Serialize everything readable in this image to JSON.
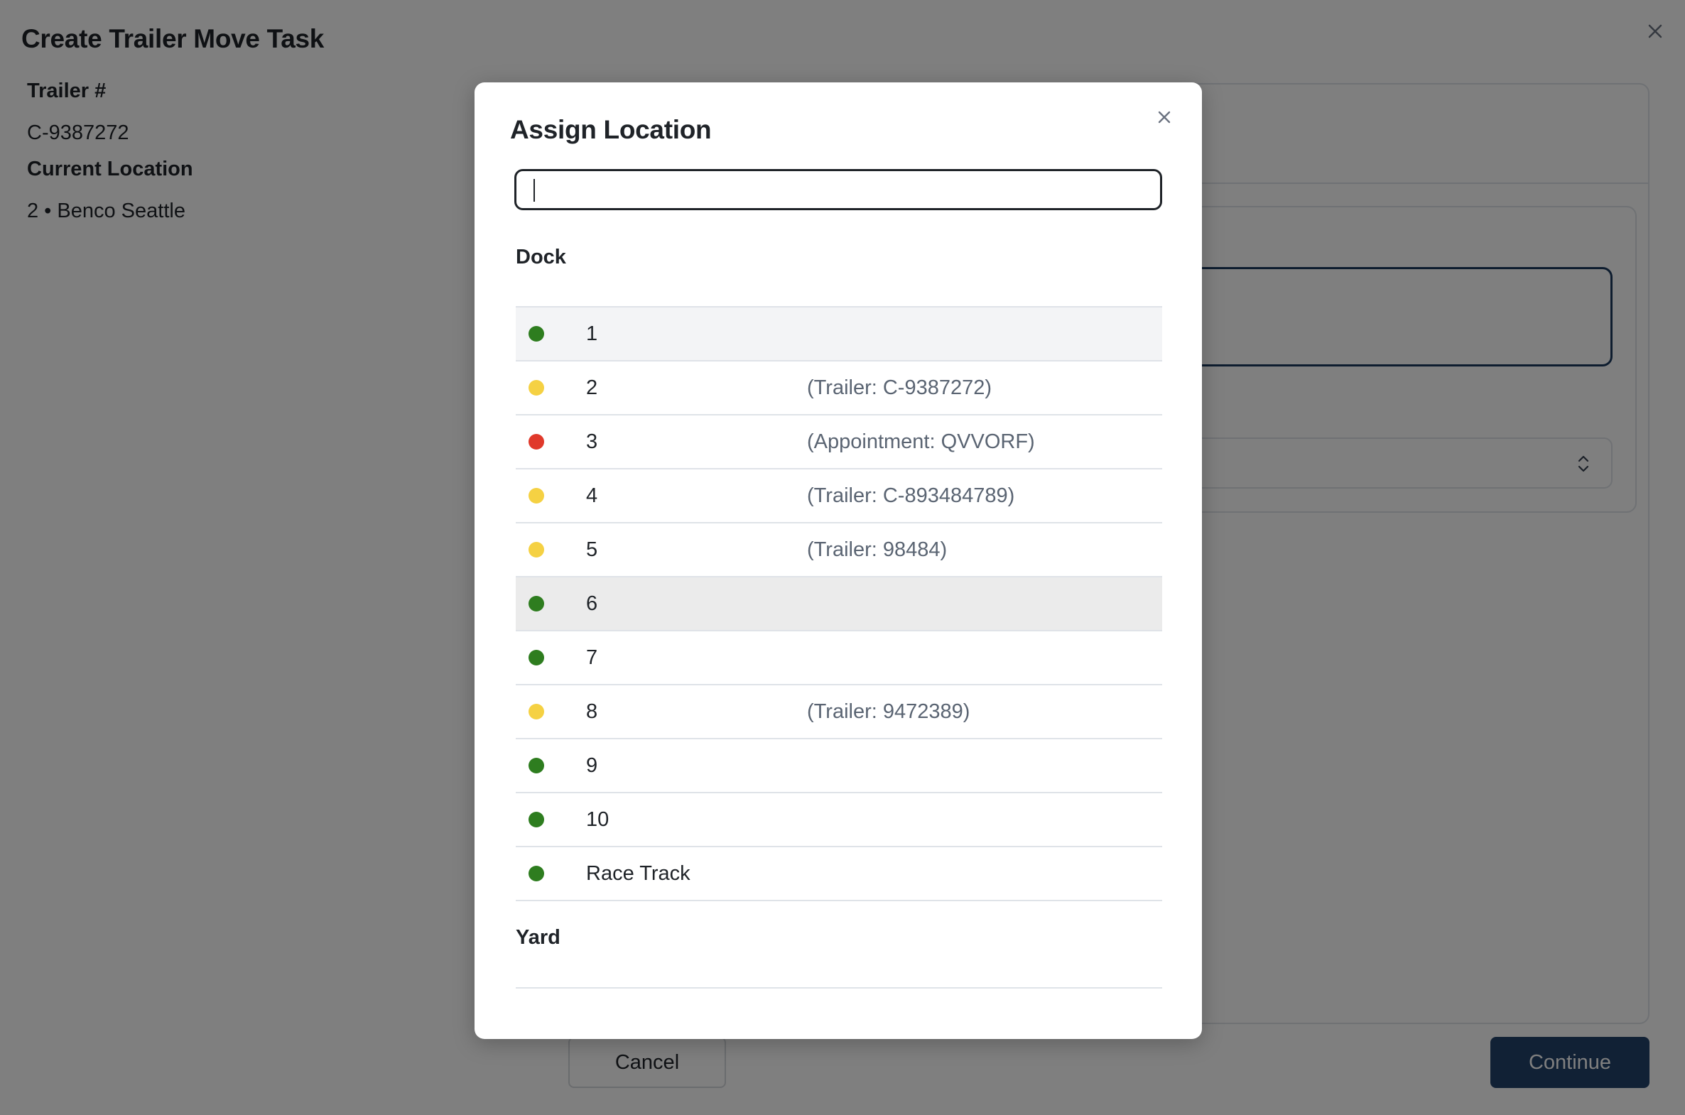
{
  "page": {
    "title": "Create Trailer Move Task",
    "trailer_label": "Trailer #",
    "trailer_value": "C-9387272",
    "current_location_label": "Current Location",
    "current_location_value": "2 • Benco Seattle",
    "cancel_label": "Cancel",
    "continue_label": "Continue",
    "close_icon": "close-icon"
  },
  "modal": {
    "title": "Assign Location",
    "search": {
      "value": "",
      "placeholder": ""
    },
    "close_icon": "close-icon",
    "sections": [
      {
        "title": "Dock",
        "items": [
          {
            "name": "1",
            "detail": "",
            "status": "available"
          },
          {
            "name": "2",
            "detail": "(Trailer: C-9387272)",
            "status": "occupied"
          },
          {
            "name": "3",
            "detail": "(Appointment: QVVORF)",
            "status": "reserved"
          },
          {
            "name": "4",
            "detail": "(Trailer: C-893484789)",
            "status": "occupied"
          },
          {
            "name": "5",
            "detail": "(Trailer: 98484)",
            "status": "occupied"
          },
          {
            "name": "6",
            "detail": "",
            "status": "available"
          },
          {
            "name": "7",
            "detail": "",
            "status": "available"
          },
          {
            "name": "8",
            "detail": "(Trailer: 9472389)",
            "status": "occupied"
          },
          {
            "name": "9",
            "detail": "",
            "status": "available"
          },
          {
            "name": "10",
            "detail": "",
            "status": "available"
          },
          {
            "name": "Race Track",
            "detail": "",
            "status": "available"
          }
        ]
      },
      {
        "title": "Yard",
        "items": []
      }
    ]
  },
  "colors": {
    "available": "#2e7d1f",
    "occupied": "#f5d143",
    "reserved": "#e0392b",
    "primary_button": "#23436b",
    "overlay": "rgba(0,0,0,0.5)"
  }
}
